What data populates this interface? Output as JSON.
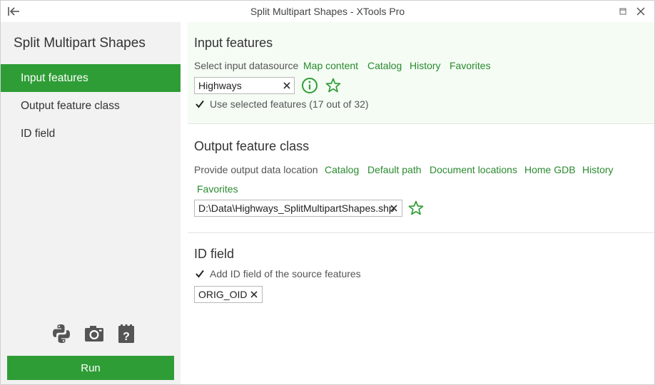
{
  "window": {
    "title": "Split Multipart Shapes - XTools Pro",
    "back_icon": "collapse-left-icon",
    "maximize_icon": "maximize-icon",
    "close_icon": "close-icon"
  },
  "sidebar": {
    "title": "Split Multipart Shapes",
    "items": [
      {
        "label": "Input features",
        "active": true
      },
      {
        "label": "Output feature class",
        "active": false
      },
      {
        "label": "ID field",
        "active": false
      }
    ],
    "tools": [
      "python-icon",
      "camera-icon",
      "clipboard-help-icon"
    ],
    "run_label": "Run"
  },
  "input_features": {
    "title": "Input features",
    "datasource_label": "Select input datasource",
    "links": [
      "Map content",
      "Catalog",
      "History",
      "Favorites"
    ],
    "value": "Highways",
    "use_selected_checked": true,
    "use_selected_label": "Use selected features (17 out of 32)"
  },
  "output_feature_class": {
    "title": "Output feature class",
    "location_label": "Provide output data location",
    "links": [
      "Catalog",
      "Default path",
      "Document locations",
      "Home GDB",
      "History",
      "Favorites"
    ],
    "value": "D:\\Data\\Highways_SplitMultipartShapes.shp"
  },
  "id_field": {
    "title": "ID field",
    "add_checked": true,
    "add_label": "Add ID field of the source features",
    "value": "ORIG_OID"
  },
  "colors": {
    "accent": "#2f9d36",
    "link": "#2a8a2f",
    "highlight_bg": "#f4fcf4",
    "sidebar_bg": "#f2f2f2"
  }
}
